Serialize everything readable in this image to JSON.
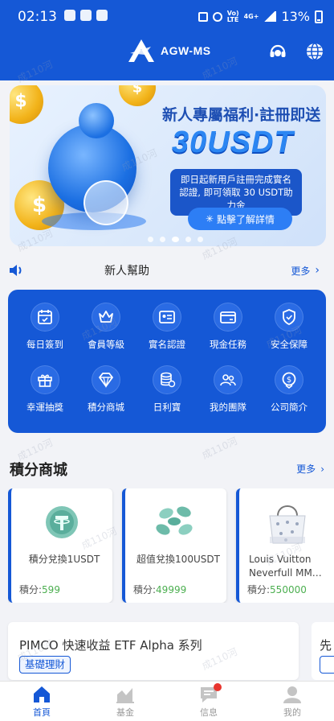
{
  "status_bar": {
    "time": "02:13",
    "net_top": "Vo)",
    "net_bottom": "LTE",
    "net_type": "4G+",
    "battery": "13%"
  },
  "header": {
    "logo_text": "AGW-MS"
  },
  "banner": {
    "title": "新人專屬福利·註冊即送",
    "amount": "30USDT",
    "desc": "即日起新用戶註冊完成實名認證, 即可領取 30 USDT助力金",
    "button": "點擊了解詳情",
    "coin_symbol": "$"
  },
  "notice": {
    "text": "新人幫助",
    "more": "更多"
  },
  "features": [
    {
      "label": "每日簽到",
      "icon": "calendar-icon"
    },
    {
      "label": "會員等級",
      "icon": "crown-icon"
    },
    {
      "label": "實名認證",
      "icon": "id-card-icon"
    },
    {
      "label": "現金任務",
      "icon": "wallet-card-icon"
    },
    {
      "label": "安全保障",
      "icon": "shield-check-icon"
    },
    {
      "label": "幸運抽獎",
      "icon": "gift-icon"
    },
    {
      "label": "積分商城",
      "icon": "diamond-icon"
    },
    {
      "label": "日利寶",
      "icon": "coin-stack-icon"
    },
    {
      "label": "我的團隊",
      "icon": "team-icon"
    },
    {
      "label": "公司簡介",
      "icon": "dollar-badge-icon"
    }
  ],
  "points_mall": {
    "title": "積分商城",
    "more": "更多",
    "points_label": "積分:",
    "items": [
      {
        "name": "積分兌換1USDT",
        "points": "599",
        "icon": "usdt-coin-icon"
      },
      {
        "name": "超值兌換100USDT",
        "points": "49999",
        "icon": "usdt-coins-icon"
      },
      {
        "name": "Louis Vuitton Neverfull MM…",
        "points": "550000",
        "icon": "handbag-icon"
      }
    ]
  },
  "products": [
    {
      "name": "PIMCO 快速收益 ETF Alpha 系列",
      "tag": "基礎理財"
    },
    {
      "name": "先",
      "tag": ""
    }
  ],
  "bottom_nav": [
    {
      "label": "首頁",
      "icon": "home-icon"
    },
    {
      "label": "基金",
      "icon": "chart-icon"
    },
    {
      "label": "信息",
      "icon": "message-icon"
    },
    {
      "label": "我的",
      "icon": "user-icon"
    }
  ],
  "watermark": "成110河",
  "colors": {
    "primary": "#1558d6",
    "accent": "#2b86f2",
    "points": "#4caf50",
    "badge": "#e8352e"
  }
}
